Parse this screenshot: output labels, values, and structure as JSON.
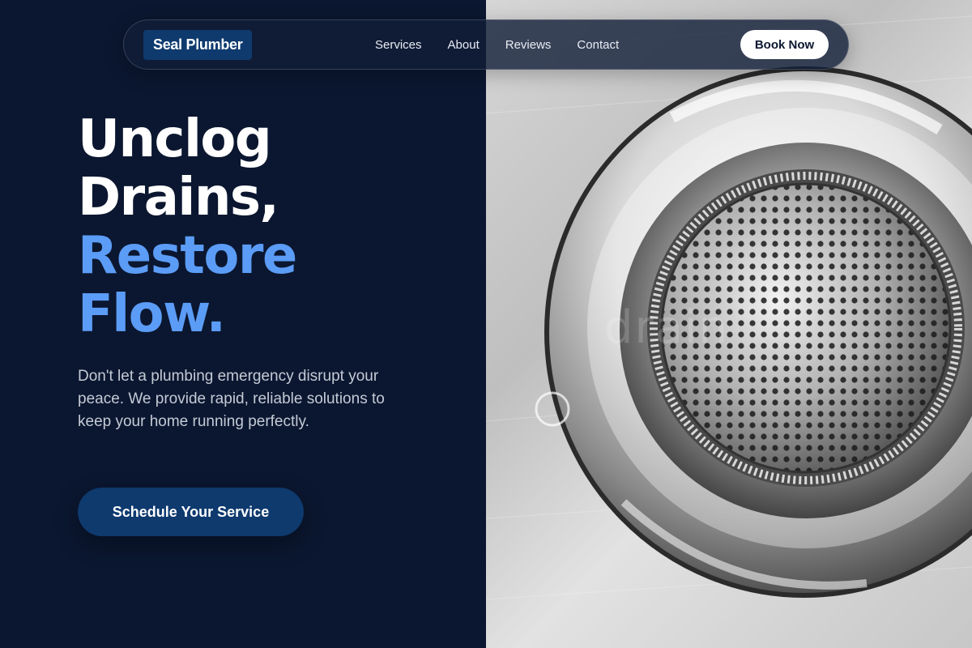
{
  "nav": {
    "brand": "Seal Plumber",
    "links": [
      "Services",
      "About",
      "Reviews",
      "Contact"
    ],
    "cta_label": "Book Now"
  },
  "hero": {
    "headline_line1": "Unclog",
    "headline_line2": "Drains,",
    "headline_line3": "Restore",
    "headline_line4": "Flow.",
    "lead": "Don't let a plumbing emergency disrupt your peace. We provide rapid, reliable solutions to keep your home running perfectly.",
    "cta_label": "Schedule Your Service"
  },
  "image": {
    "subject": "stainless steel sink drain strainer",
    "watermark": "drain"
  },
  "colors": {
    "background": "#0b1730",
    "brand": "#0e3a6e",
    "accent": "#5b9cf6",
    "text_muted": "#c4cad6",
    "white": "#ffffff"
  }
}
